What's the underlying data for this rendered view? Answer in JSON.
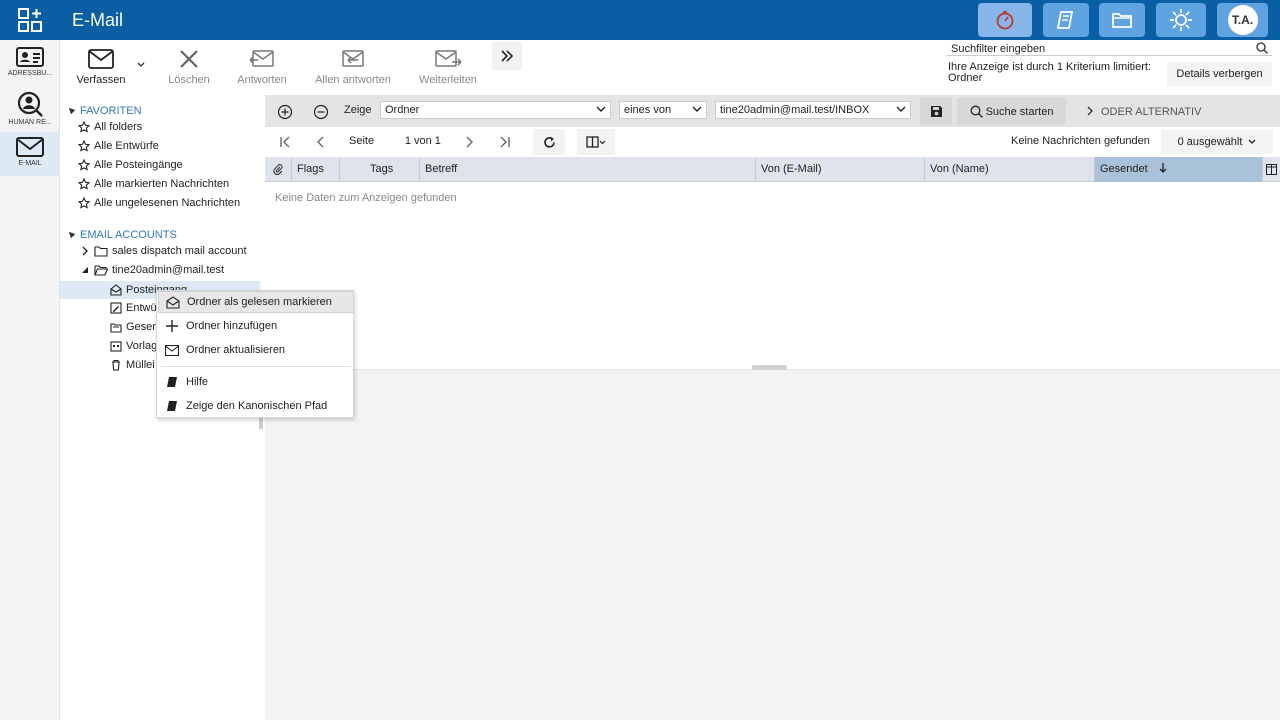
{
  "app": {
    "title": "E-Mail",
    "avatar_initials": "T.A."
  },
  "rail": {
    "items": [
      {
        "label": "ADRESSBU..."
      },
      {
        "label": "HUMAN RE..."
      },
      {
        "label": "E-MAIL"
      }
    ]
  },
  "toolbar": {
    "compose": "Verfassen",
    "delete": "Löschen",
    "reply": "Antworten",
    "reply_all": "Allen antworten",
    "forward": "Weiterleiten"
  },
  "search": {
    "placeholder": "Suchfilter eingeben",
    "filter_info": "Ihre Anzeige ist durch 1 Kriterium limitiert: Ordner",
    "details_button": "Details verbergen"
  },
  "tree": {
    "favorites_heading": "FAVORITEN",
    "favorites": [
      "All folders",
      "Alle Entwürfe",
      "Alle Posteingänge",
      "Alle markierten Nachrichten",
      "Alle ungelesenen Nachrichten"
    ],
    "accounts_heading": "EMAIL ACCOUNTS",
    "accounts": [
      "sales dispatch mail account",
      "tine20admin@mail.test"
    ],
    "folders": [
      "Posteingang",
      "Entwü",
      "Gesen",
      "Vorlag",
      "Müllei"
    ]
  },
  "filterbar": {
    "show_label": "Zeige",
    "field": "Ordner",
    "operator": "eines von",
    "value": "tine20admin@mail.test/INBOX",
    "search_button": "Suche starten",
    "or_alternative": "ODER ALTERNATIV"
  },
  "paging": {
    "page_label": "Seite",
    "page_value": "1",
    "of_label": "von 1",
    "no_messages": "Keine Nachrichten gefunden",
    "selected": "0 ausgewählt"
  },
  "grid": {
    "columns": [
      "Flags",
      "Tags",
      "Betreff",
      "Von (E-Mail)",
      "Von (Name)",
      "Gesendet"
    ],
    "empty_text": "Keine Daten zum Anzeigen gefunden"
  },
  "context_menu": {
    "items": [
      "Ordner als gelesen markieren",
      "Ordner hinzufügen",
      "Ordner aktualisieren",
      "Hilfe",
      "Zeige den Kanonischen Pfad"
    ]
  },
  "colors": {
    "topbar": "#0a5fa4",
    "top_button": "#5fa3e0",
    "link_blue": "#2f79c0",
    "sorted_column": "#a9c1d9"
  }
}
